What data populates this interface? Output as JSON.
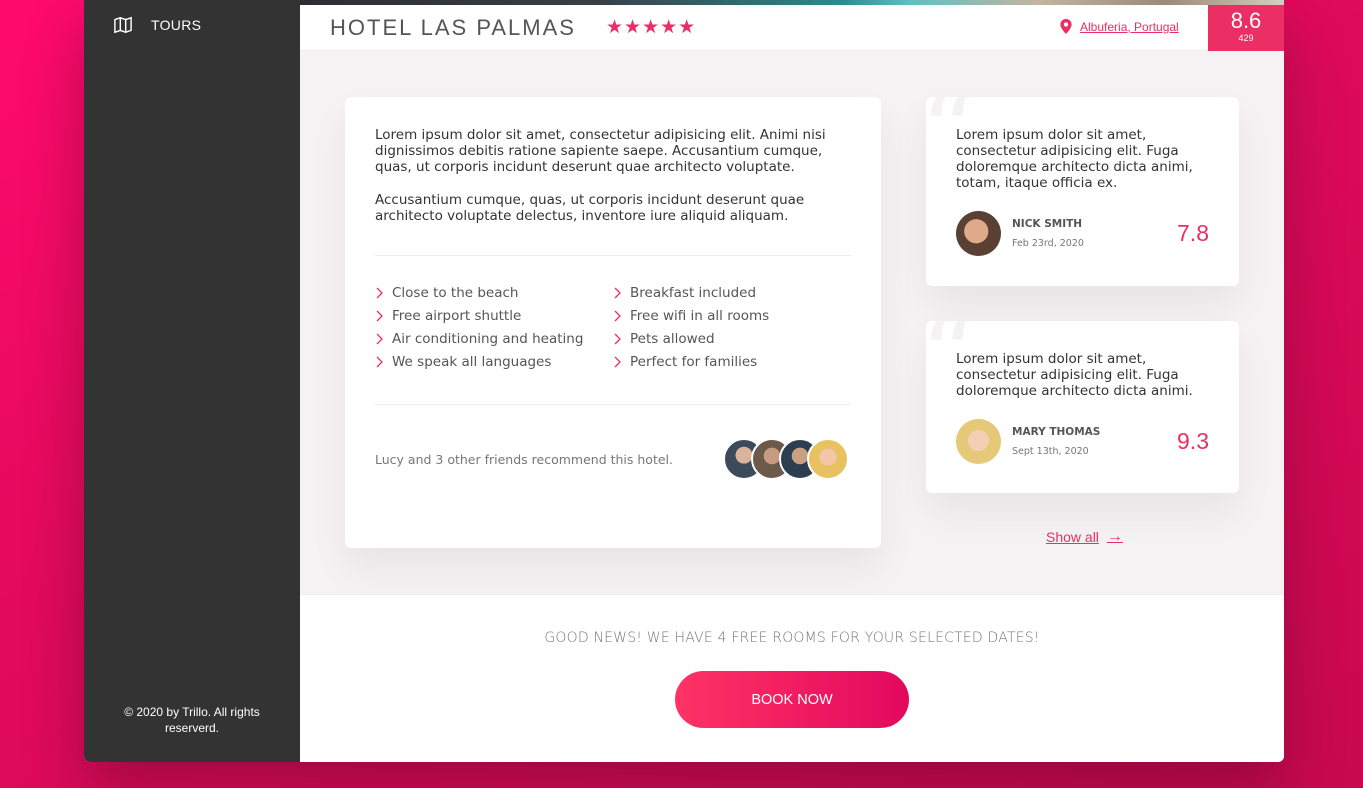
{
  "sidebar": {
    "items": [
      {
        "label": "TOURS",
        "icon": "map-icon"
      }
    ],
    "copyright": "© 2020 by Trillo. All rights reserverd."
  },
  "overview": {
    "hotel_name": "HOTEL LAS PALMAS",
    "stars": [
      "★",
      "★",
      "★",
      "★",
      "★"
    ],
    "location": "Albuferia, Portugal",
    "rating_average": "8.6",
    "rating_count": "429"
  },
  "description": {
    "paragraphs": [
      "Lorem ipsum dolor sit amet, consectetur adipisicing elit. Animi nisi dignissimos debitis ratione sapiente saepe. Accusantium cumque, quas, ut corporis incidunt deserunt quae architecto voluptate.",
      "Accusantium cumque, quas, ut corporis incidunt deserunt quae architecto voluptate delectus, inventore iure aliquid aliquam."
    ],
    "features": [
      "Close to the beach",
      "Breakfast included",
      "Free airport shuttle",
      "Free wifi in all rooms",
      "Air conditioning and heating",
      "Pets allowed",
      "We speak all languages",
      "Perfect for families"
    ],
    "recommend_text": "Lucy and 3 other friends recommend this hotel."
  },
  "reviews": [
    {
      "text": "Lorem ipsum dolor sit amet, consectetur adipisicing elit. Fuga doloremque architecto dicta animi, totam, itaque officia ex.",
      "name": "Nick Smith",
      "date": "Feb 23rd, 2020",
      "rating": "7.8"
    },
    {
      "text": "Lorem ipsum dolor sit amet, consectetur adipisicing elit. Fuga doloremque architecto dicta animi.",
      "name": "Mary Thomas",
      "date": "Sept 13th, 2020",
      "rating": "9.3"
    }
  ],
  "show_all": {
    "label": "Show all",
    "arrow": "→"
  },
  "cta": {
    "text": "Good news! We have 4 free rooms for your selected dates!",
    "button": "Book now"
  },
  "colors": {
    "accent": "#eb2f64",
    "sidebar": "#333333"
  }
}
